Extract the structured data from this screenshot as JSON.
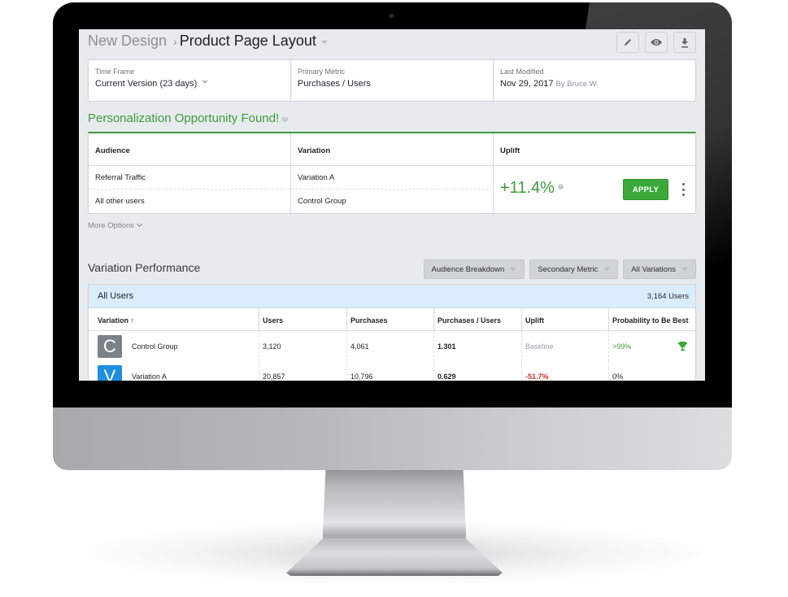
{
  "header": {
    "breadcrumb_parent": "New Design",
    "breadcrumb_separator": "›",
    "page_title": "Product Page Layout",
    "tools": [
      {
        "name": "edit",
        "icon": "pencil-icon"
      },
      {
        "name": "preview",
        "icon": "eye-icon"
      },
      {
        "name": "download",
        "icon": "download-icon"
      }
    ]
  },
  "info_bar": {
    "time_frame": {
      "label": "Time Frame",
      "value": "Current Version (23 days)"
    },
    "primary_metric": {
      "label": "Primary Metric",
      "value": "Purchases / Users"
    },
    "last_modified": {
      "label": "Last Modified",
      "value": "Nov 29, 2017",
      "by": "By Bruce W."
    }
  },
  "opportunity": {
    "title": "Personalization Opportunity Found!",
    "help": "?",
    "columns": [
      "Audience",
      "Variation",
      "Uplift"
    ],
    "rows": [
      {
        "audience": "Referral Traffic",
        "variation": "Variation A"
      },
      {
        "audience": "All other users",
        "variation": "Control Group"
      }
    ],
    "uplift": "+11.4%",
    "apply_label": "APPLY",
    "more_options": "More Options"
  },
  "performance": {
    "title": "Variation Performance",
    "filters": [
      "Audience Breakdown",
      "Secondary Metric",
      "All Variations"
    ],
    "segment": {
      "name": "All Users",
      "count": "3,164 Users"
    },
    "columns": [
      "Variation ↑",
      "Users",
      "Purchases",
      "Purchases / Users",
      "Uplift",
      "Probability to Be Best"
    ],
    "rows": [
      {
        "badge": "C",
        "badge_color": "#7b8389",
        "variation": "Control Group",
        "users": "3,120",
        "purchases": "4,061",
        "ratio": "1.301",
        "uplift": "Baseline",
        "probability": ">99%",
        "winner": true
      },
      {
        "badge": "V",
        "badge_color": "#1e8ee0",
        "variation": "Variation A",
        "users": "20,857",
        "purchases": "10,796",
        "ratio": "0.629",
        "uplift": "-51.7%",
        "probability": "0%",
        "winner": false
      }
    ]
  },
  "colors": {
    "accent_green": "#3f9a3e",
    "apply_green": "#3aa93a",
    "negative_red": "#c9302c",
    "segment_blue": "#d9eefa"
  }
}
